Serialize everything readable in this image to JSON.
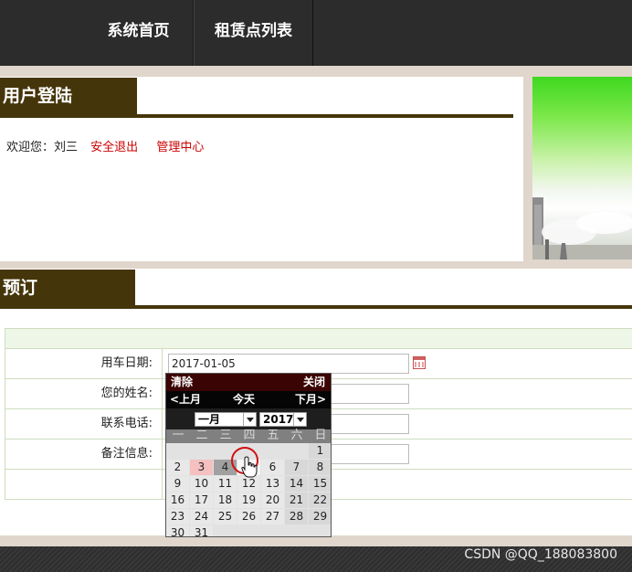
{
  "nav": {
    "items": [
      {
        "label": "系统首页"
      },
      {
        "label": "租赁点列表"
      }
    ]
  },
  "login": {
    "title": "用户登陆",
    "welcome_prefix": "欢迎您：",
    "username": "刘三",
    "logout": "安全退出",
    "admin": "管理中心"
  },
  "booking": {
    "title": "预订",
    "fields": [
      {
        "label": "用车日期:",
        "value": "2017-01-05"
      },
      {
        "label": "您的姓名:",
        "value": ""
      },
      {
        "label": "联系电话:",
        "value": ""
      },
      {
        "label": "备注信息:",
        "value": ""
      }
    ]
  },
  "calendar": {
    "clear": "清除",
    "close": "关闭",
    "prev": "<上月",
    "today": "今天",
    "next": "下月>",
    "month": "一月",
    "year": "2017",
    "weekdays": [
      "一",
      "二",
      "三",
      "四",
      "五",
      "六",
      "日"
    ],
    "weeks": [
      [
        "",
        "",
        "",
        "",
        "",
        "",
        "1"
      ],
      [
        "2",
        "3",
        "4",
        "5",
        "6",
        "7",
        "8"
      ],
      [
        "9",
        "10",
        "11",
        "12",
        "13",
        "14",
        "15"
      ],
      [
        "16",
        "17",
        "18",
        "19",
        "20",
        "21",
        "22"
      ],
      [
        "23",
        "24",
        "25",
        "26",
        "27",
        "28",
        "29"
      ],
      [
        "30",
        "31",
        "",
        "",
        "",
        "",
        ""
      ]
    ],
    "today_day": "3",
    "selected_day": "4",
    "hover_day": "5"
  },
  "footer": {
    "watermark": "CSDN @QQ_188083800"
  },
  "colors": {
    "nav_bg": "#2c2c2c",
    "title_bg": "#45350a",
    "link": "#cc0000",
    "page_bg": "#e0d6cc"
  }
}
